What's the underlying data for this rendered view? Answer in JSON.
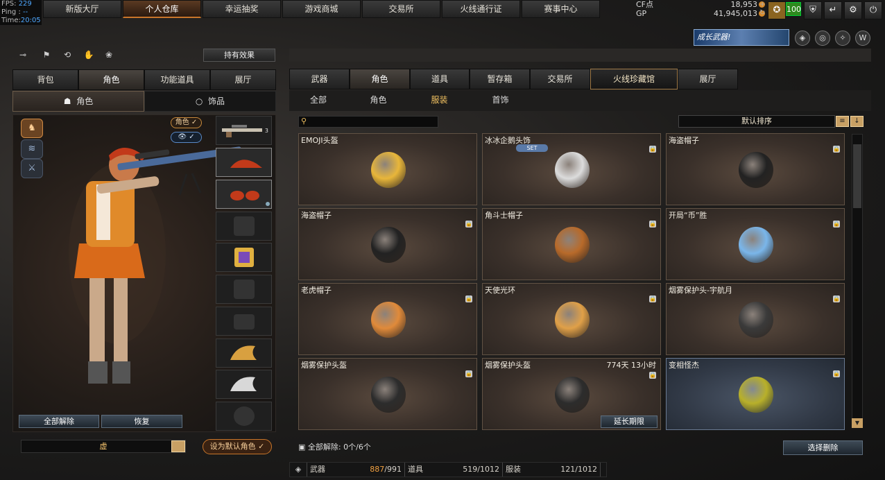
{
  "fps_panel": {
    "fps_label": "FPS:",
    "fps_value": "229",
    "ping_label": "Ping :",
    "ping_value": "--",
    "time_label": "Time:",
    "time_value": "20:05"
  },
  "top_nav": [
    "新版大厅",
    "个人仓库",
    "幸运抽奖",
    "游戏商城",
    "交易所",
    "火线通行证",
    "赛事中心"
  ],
  "top_nav_active": "个人仓库",
  "currency": {
    "cf_label": "CF点",
    "cf_value": "18,953",
    "gp_label": "GP",
    "gp_value": "41,945,013"
  },
  "level": "100",
  "banner_text": "成长武器!",
  "hold_effect_button": "持有效果",
  "left_tabs": [
    "背包",
    "角色",
    "功能道具",
    "展厅"
  ],
  "left_subtabs": [
    "角色",
    "饰品"
  ],
  "toggles": {
    "role": "角色 ✓",
    "view": "👁 ✓"
  },
  "slot_weapon_count": "3",
  "left_buttons": {
    "unlock_all": "全部解除",
    "restore": "恢复"
  },
  "name_input": "虚",
  "set_default": "设为默认角色",
  "right_tabs": [
    "武器",
    "角色",
    "道具",
    "暂存箱",
    "交易所",
    "火线珍藏馆",
    "展厅"
  ],
  "right_subtabs": [
    "全部",
    "角色",
    "服装",
    "首饰"
  ],
  "sort_label": "默认排序",
  "items": [
    {
      "name": "EMOJI头盔",
      "color": "#e8b63a",
      "locked": false
    },
    {
      "name": "冰冰企鹅头饰",
      "color": "#dcdcdc",
      "locked": true,
      "set": "SET"
    },
    {
      "name": "海盗帽子",
      "color": "#222222",
      "locked": true
    },
    {
      "name": "海盗帽子",
      "color": "#222222",
      "locked": true
    },
    {
      "name": "角斗士帽子",
      "color": "#b86a2a",
      "locked": true
    },
    {
      "name": "开局“币”胜",
      "color": "#7ab6ea",
      "locked": true
    },
    {
      "name": "老虎帽子",
      "color": "#e08a3a",
      "locked": true
    },
    {
      "name": "天使光环",
      "color": "#e0a048",
      "locked": true
    },
    {
      "name": "烟雾保护头-宇航月",
      "color": "#3a3a3a",
      "locked": true
    },
    {
      "name": "烟雾保护头盔",
      "color": "#2c2c2c",
      "locked": true
    },
    {
      "name": "烟雾保护头盔",
      "color": "#2c2c2c",
      "locked": true,
      "time": "774天 13小时",
      "extend": "延长期限"
    },
    {
      "name": "变相怪杰",
      "color": "#b8b02a",
      "locked": true,
      "highlight": true
    }
  ],
  "footer": {
    "unlock_info": "全部解除:  0个/6个",
    "select_delete": "选择删除"
  },
  "stats": [
    {
      "label": "武器",
      "count": "887",
      "total": "/991"
    },
    {
      "label": "道具",
      "count": "519",
      "total": "/1012"
    },
    {
      "label": "服装",
      "count": "121",
      "total": "/1012"
    }
  ]
}
